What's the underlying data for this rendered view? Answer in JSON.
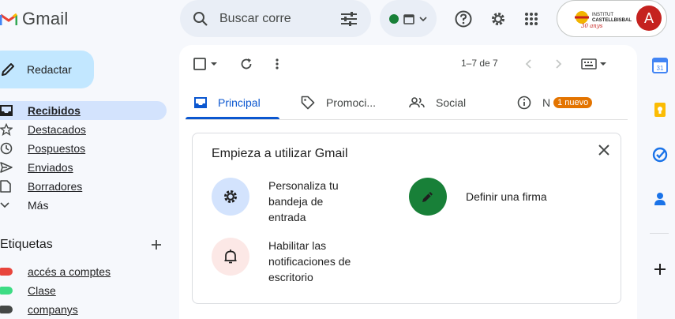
{
  "app": {
    "name": "Gmail"
  },
  "search": {
    "placeholder": "Buscar corre"
  },
  "account": {
    "avatar_letter": "A",
    "org_logo_text": "INSTITUT CASTELLBISBAL"
  },
  "compose": {
    "label": "Redactar"
  },
  "sidebar": {
    "items": [
      {
        "label": "Recibidos",
        "icon": "inbox-icon",
        "active": true
      },
      {
        "label": "Destacados",
        "icon": "star-icon"
      },
      {
        "label": "Pospuestos",
        "icon": "clock-icon"
      },
      {
        "label": "Enviados",
        "icon": "send-icon"
      },
      {
        "label": "Borradores",
        "icon": "draft-icon"
      },
      {
        "label": "Más",
        "icon": "chevron-down-icon"
      }
    ],
    "labels_title": "Etiquetas",
    "labels": [
      {
        "label": "accés a comptes",
        "color": "#e8453c"
      },
      {
        "label": "Clase",
        "color": "#3ddc84"
      },
      {
        "label": "companys",
        "color": "#444746"
      }
    ]
  },
  "toolbar": {
    "pager": "1–7 de 7"
  },
  "tabs": [
    {
      "label": "Principal",
      "icon": "inbox-tab-icon",
      "active": true
    },
    {
      "label": "Promoci...",
      "icon": "tag-icon"
    },
    {
      "label": "Social",
      "icon": "people-icon"
    },
    {
      "label": "N",
      "icon": "info-icon",
      "badge": "1 nuevo"
    }
  ],
  "welcome_card": {
    "title": "Empieza a utilizar Gmail",
    "tips": [
      {
        "text": "Personaliza tu bandeja de entrada",
        "icon": "gear-icon",
        "color": "#d3e3fd"
      },
      {
        "text": "Definir una firma",
        "icon": "pen-icon",
        "color": "#188038"
      },
      {
        "text": "Habilitar las notificaciones de escritorio",
        "icon": "bell-icon",
        "color": "#fce8e6"
      }
    ]
  },
  "colors": {
    "accent": "#0b57d0",
    "compose": "#c2e7ff",
    "badge": "#e37400"
  }
}
